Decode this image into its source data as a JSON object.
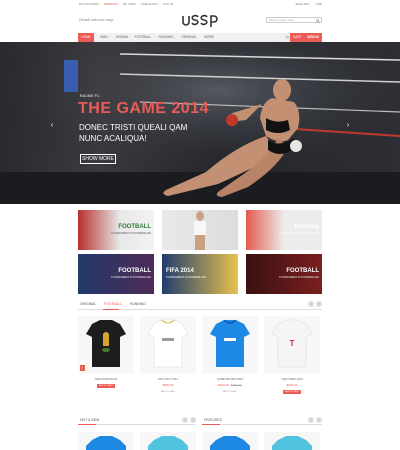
{
  "topbar": {
    "account": "MY ACCOUNT",
    "wishlist": "WISHLIST",
    "cart": "MY CART",
    "checkout": "CHECKOUT",
    "login": "LOG IN",
    "language": "ENGLISH",
    "currency": "USD"
  },
  "header": {
    "welcome": "Default welcome msg!",
    "search_placeholder": "Search entire store"
  },
  "nav": {
    "items": [
      {
        "label": "HOME"
      },
      {
        "label": "MAN"
      },
      {
        "label": "WOMAN"
      },
      {
        "label": "FOOTBALL"
      },
      {
        "label": "RUNNING"
      },
      {
        "label": "ORIGINAL"
      },
      {
        "label": "MORE"
      }
    ],
    "cart_label": "CART",
    "cart_total": "$290.00"
  },
  "hero": {
    "eyebrow": "RAUMS FC",
    "title": "THE GAME 2014",
    "subtitle": "DONEC TRISTI QUEALI QAM NUNC ACALIQUA!",
    "button": "SHOW MORE"
  },
  "categories": [
    {
      "title": "FOOTBALL",
      "sub": "TOURNAMENT IN POSSENE AMI"
    },
    {
      "title": "",
      "sub": ""
    },
    {
      "title": "Running",
      "sub": "TOURNAMENT IN POSSENE AMI"
    },
    {
      "title": "FOOTBALL",
      "sub": "TOURNAMENT IN POSSENE AMI"
    },
    {
      "title": "FIFA 2014",
      "sub": "TOURNAMENT IN POSSENE AMI"
    },
    {
      "title": "FOOTBALL",
      "sub": "TOURNAMENT IN POSSENE AMI"
    }
  ],
  "product_tabs": [
    "ORIGINAL",
    "FOOTBALL",
    "RUNNING"
  ],
  "products": [
    {
      "name": "TEES WORLDCUP",
      "price": "",
      "old_price": "",
      "button": "ADD TO CART"
    },
    {
      "name": "FIFA 4 RAY 2014",
      "price": "$350.00",
      "old_price": "",
      "button": "ADD TO CART"
    },
    {
      "name": "HOME RETURN 2018",
      "price": "$230.00",
      "old_price": "$350.00",
      "button": "ADD TO CART"
    },
    {
      "name": "THE TOREO 2014",
      "price": "$330.00",
      "old_price": "",
      "button": "ADD TO CART"
    }
  ],
  "sections": {
    "hot_new": "HOT & NEW",
    "featured": "FEATURED"
  },
  "colors": {
    "accent": "#ec5b55",
    "nav_bg": "#f1f1f1"
  }
}
